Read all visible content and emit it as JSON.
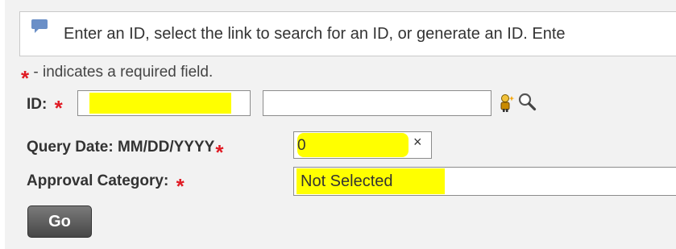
{
  "info": {
    "text": "Enter an ID, select the link to search for an ID, or generate an ID. Ente"
  },
  "required_note": "- indicates a required field.",
  "required_marker": "*",
  "fields": {
    "id_label": "ID:",
    "query_date_label": "Query Date: MM/DD/YYYY",
    "query_date_value": "0",
    "clear_symbol": "×",
    "approval_label": "Approval Category:",
    "approval_value": "Not Selected"
  },
  "buttons": {
    "go": "Go"
  },
  "icons": {
    "info": "speech-bubble-icon",
    "id_tool": "person-icon",
    "search": "magnifier-icon"
  },
  "colors": {
    "highlight": "#ffff00",
    "required": "#e01b24",
    "button": "#555555"
  }
}
